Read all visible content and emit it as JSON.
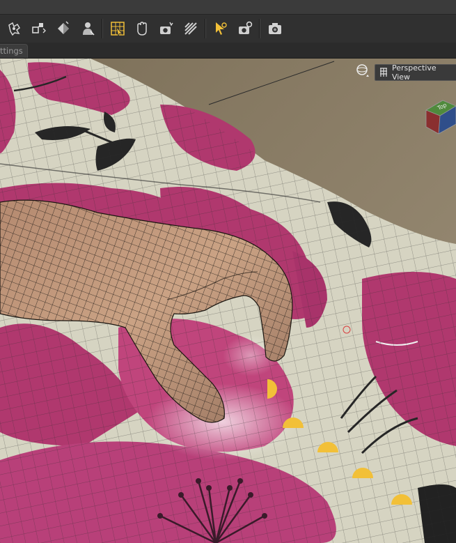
{
  "toolbar": {
    "tools": [
      {
        "icon": "node-weight-brush-icon"
      },
      {
        "icon": "transform-icon"
      },
      {
        "icon": "surface-selection-icon"
      },
      {
        "icon": "figure-tool-icon"
      },
      {
        "icon": "geometry-editor-icon",
        "active": true
      },
      {
        "icon": "pose-hand-icon"
      },
      {
        "icon": "camera-selection-icon"
      },
      {
        "icon": "spotrender-icon"
      },
      {
        "icon": "active-pose-pointer-icon"
      },
      {
        "icon": "camera-settings-icon"
      },
      {
        "icon": "render-camera-icon"
      }
    ],
    "accent_color": "#f2c038"
  },
  "tabs": {
    "settings_tab": "ttings"
  },
  "viewport": {
    "camera_label": "Perspective View",
    "nav_cube_label": "Top"
  }
}
